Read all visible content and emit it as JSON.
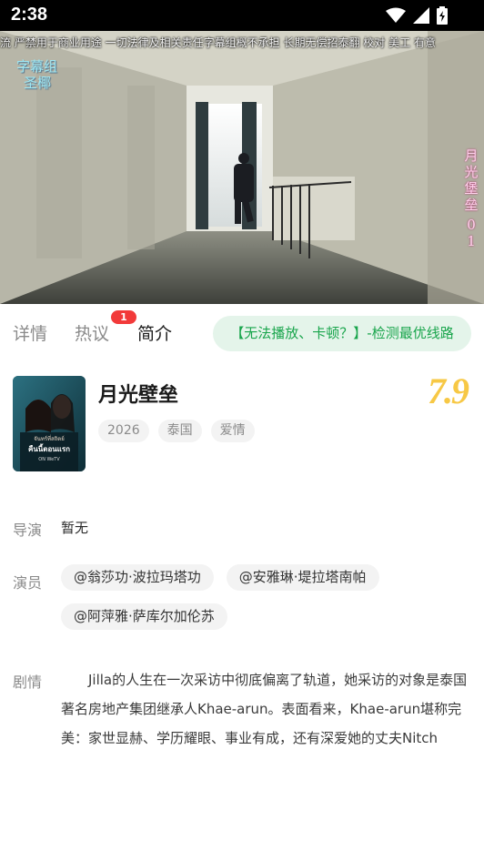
{
  "status_bar": {
    "time": "2:38"
  },
  "video": {
    "marquee": "流 严禁用于商业用途 一切法律及相关责任字幕组概不承担 长期无偿招泰翻 校对 美工 有意",
    "watermark": [
      "字幕组",
      "圣椰"
    ],
    "overlay_title": "月光堡垒",
    "episode": "01"
  },
  "tabs": [
    {
      "label": "详情",
      "active": false
    },
    {
      "label": "热议",
      "active": false,
      "badge": "1"
    },
    {
      "label": "简介",
      "active": true
    }
  ],
  "detect_button": "【无法播放、卡顿？】-检测最优线路",
  "show": {
    "title": "月光壁垒",
    "tags": [
      "2026",
      "泰国",
      "爱情"
    ],
    "rating": "7.9",
    "poster_text": [
      "จันทร์ที่สถิตย์",
      "คืนนี้ตอนแรก",
      "ON WeTV"
    ]
  },
  "director": {
    "label": "导演",
    "value": "暂无"
  },
  "actors": {
    "label": "演员",
    "items": [
      "@翁莎功·波拉玛塔功",
      "@安雅琳·堤拉塔南帕",
      "@阿萍雅·萨库尔加伦苏"
    ]
  },
  "plot": {
    "label": "剧情",
    "text": "Jilla的人生在一次采访中彻底偏离了轨道，她采访的对象是泰国著名房地产集团继承人Khae-arun。表面看来，Khae-arun堪称完美：家世显赫、学历耀眼、事业有成，还有深爱她的丈夫Nitch"
  },
  "colors": {
    "accent_green": "#19a54c",
    "badge_red": "#f23a3a",
    "rating_gold": "#f7c845"
  }
}
